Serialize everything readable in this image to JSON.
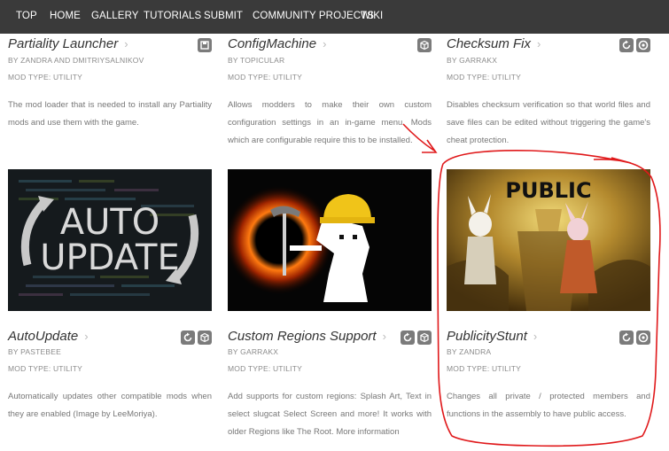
{
  "nav": {
    "items": [
      "TOP",
      "HOME",
      "GALLERY",
      "TUTORIALS",
      "SUBMIT",
      "COMMUNITY PROJECTS",
      "WIKI"
    ]
  },
  "mods": [
    {
      "title": "Partiality Launcher",
      "by": "BY ZANDRA AND DMITRIYSALNIKOV",
      "type": "MOD TYPE: UTILITY",
      "description": "The mod loader that is needed to install any Partiality mods and use them with the game.",
      "icons": [
        "floppy-icon"
      ]
    },
    {
      "title": "ConfigMachine",
      "by": "BY TOPICULAR",
      "type": "MOD TYPE: UTILITY",
      "description": "Allows modders to make their own custom configuration settings in an in-game menu. Mods which are configurable require this to be installed.",
      "icons": [
        "box-icon"
      ]
    },
    {
      "title": "Checksum Fix",
      "by": "BY GARRAKX",
      "type": "MOD TYPE: UTILITY",
      "description": "Disables checksum verification so that world files and save files can be edited without triggering the game's cheat protection.",
      "icons": [
        "update-icon",
        "gear-icon"
      ]
    },
    {
      "title": "AutoUpdate",
      "by": "BY PASTEBEE",
      "type": "MOD TYPE: UTILITY",
      "description": "Automatically updates other compatible mods when they are enabled (Image by LeeMoriya).",
      "icons": [
        "update-icon",
        "box-icon"
      ],
      "thumb_text": [
        "AUTO",
        "UPDATE"
      ]
    },
    {
      "title": "Custom Regions Support",
      "by": "BY GARRAKX",
      "type": "MOD TYPE: UTILITY",
      "description": "Add supports for custom regions: Splash Art, Text in select slugcat Select Screen and more! It works with older Regions like The Root. More information",
      "icons": [
        "update-icon",
        "box-icon"
      ]
    },
    {
      "title": "PublicityStunt",
      "by": "BY ZANDRA",
      "type": "MOD TYPE: UTILITY",
      "description": "Changes all private / protected members and functions in the assembly to have public access.",
      "icons": [
        "update-icon",
        "gear-icon"
      ],
      "thumb_text": [
        "PUBLIC"
      ]
    }
  ],
  "colors": {
    "nav_bg": "#3a3a3a",
    "icon_bg": "#7b7b7b",
    "annotation": "#e0191b"
  }
}
